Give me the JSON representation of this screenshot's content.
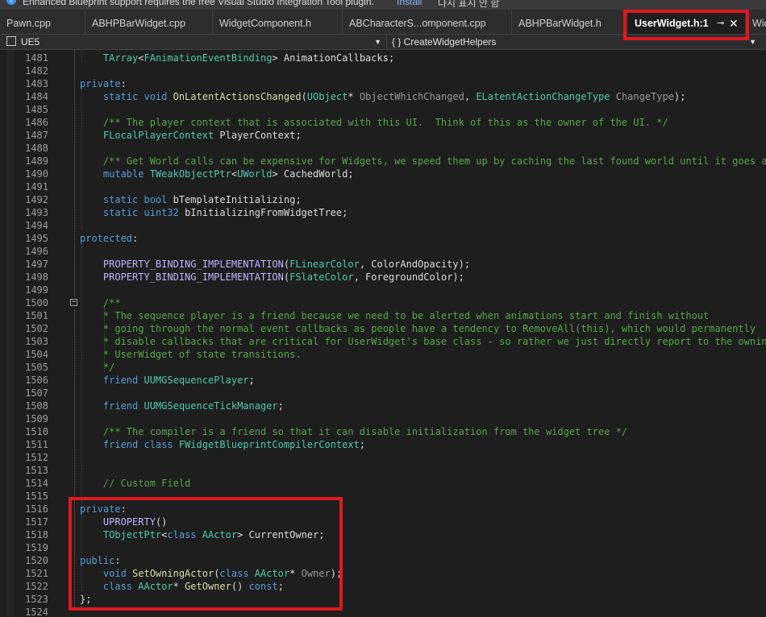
{
  "infobar": {
    "message": "Enhanced Blueprint support requires the free Visual Studio Integration Tool plugin.",
    "install_label": "Install",
    "dont_show_label": "다시 표시 안 함"
  },
  "tabs": [
    {
      "label": "Pawn.cpp"
    },
    {
      "label": "ABHPBarWidget.cpp"
    },
    {
      "label": "WidgetComponent.h"
    },
    {
      "label": "ABCharacterS...omponent.cpp"
    },
    {
      "label": "ABHPBarWidget.h"
    },
    {
      "label": "UserWidget.h:1",
      "active": true
    },
    {
      "label": "Widg"
    }
  ],
  "tab_controls": {
    "pin": "⊸",
    "close": "✕"
  },
  "navbar": {
    "project": "UE5",
    "member": "{ } CreateWidgetHelpers"
  },
  "colors": {
    "highlight_box": "#e0181d",
    "active_tab_accent": "#9d7ff0",
    "keyword": "#569cd6",
    "type": "#4ec9b0",
    "function": "#dcdcaa",
    "comment": "#57a64a",
    "macro": "#beb7ff"
  },
  "code_lines": [
    {
      "n": "1481",
      "tokens": [
        [
          "i2",
          ""
        ],
        [
          "ty",
          "TArray"
        ],
        [
          "p",
          "<"
        ],
        [
          "ty",
          "FAnimationEventBinding"
        ],
        [
          "p",
          "> AnimationCallbacks;"
        ]
      ]
    },
    {
      "n": "1482",
      "tokens": []
    },
    {
      "n": "1483",
      "tokens": [
        [
          "kw",
          "private"
        ],
        [
          "p",
          ":"
        ]
      ]
    },
    {
      "n": "1484",
      "tokens": [
        [
          "i2",
          ""
        ],
        [
          "kw",
          "static void "
        ],
        [
          "fn",
          "OnLatentActionsChanged"
        ],
        [
          "p",
          "("
        ],
        [
          "ty",
          "UObject"
        ],
        [
          "p",
          "* "
        ],
        [
          "pa",
          "ObjectWhichChanged"
        ],
        [
          "p",
          ", "
        ],
        [
          "ty",
          "ELatentActionChangeType"
        ],
        [
          "p",
          " "
        ],
        [
          "pa",
          "ChangeType"
        ],
        [
          "p",
          ");"
        ]
      ]
    },
    {
      "n": "1485",
      "tokens": []
    },
    {
      "n": "1486",
      "tokens": [
        [
          "i2",
          ""
        ],
        [
          "cm",
          "/** The player context that is associated with this UI.  Think of this as the owner of the UI. */"
        ]
      ]
    },
    {
      "n": "1487",
      "tokens": [
        [
          "i2",
          ""
        ],
        [
          "ty",
          "FLocalPlayerContext"
        ],
        [
          "p",
          " PlayerContext;"
        ]
      ]
    },
    {
      "n": "1488",
      "tokens": []
    },
    {
      "n": "1489",
      "tokens": [
        [
          "i2",
          ""
        ],
        [
          "cm",
          "/** Get World calls can be expensive for Widgets, we speed them up by caching the last found world until it goes away. */"
        ]
      ]
    },
    {
      "n": "1490",
      "tokens": [
        [
          "i2",
          ""
        ],
        [
          "kw",
          "mutable "
        ],
        [
          "ty",
          "TWeakObjectPtr"
        ],
        [
          "p",
          "<"
        ],
        [
          "ty",
          "UWorld"
        ],
        [
          "p",
          "> CachedWorld;"
        ]
      ]
    },
    {
      "n": "1491",
      "tokens": []
    },
    {
      "n": "1492",
      "tokens": [
        [
          "i2",
          ""
        ],
        [
          "kw",
          "static bool "
        ],
        [
          "p",
          "bTemplateInitializing;"
        ]
      ]
    },
    {
      "n": "1493",
      "tokens": [
        [
          "i2",
          ""
        ],
        [
          "kw",
          "static uint32 "
        ],
        [
          "p",
          "bInitializingFromWidgetTree;"
        ]
      ]
    },
    {
      "n": "1494",
      "tokens": []
    },
    {
      "n": "1495",
      "tokens": [
        [
          "kw",
          "protected"
        ],
        [
          "p",
          ":"
        ]
      ]
    },
    {
      "n": "1496",
      "tokens": []
    },
    {
      "n": "1497",
      "tokens": [
        [
          "i2",
          ""
        ],
        [
          "mac",
          "PROPERTY_BINDING_IMPLEMENTATION"
        ],
        [
          "p",
          "("
        ],
        [
          "ty",
          "FLinearColor"
        ],
        [
          "p",
          ", ColorAndOpacity);"
        ]
      ]
    },
    {
      "n": "1498",
      "tokens": [
        [
          "i2",
          ""
        ],
        [
          "mac",
          "PROPERTY_BINDING_IMPLEMENTATION"
        ],
        [
          "p",
          "("
        ],
        [
          "ty",
          "FSlateColor"
        ],
        [
          "p",
          ", ForegroundColor);"
        ]
      ]
    },
    {
      "n": "1499",
      "tokens": []
    },
    {
      "n": "1500",
      "tokens": [
        [
          "i2",
          ""
        ],
        [
          "cm",
          "/**"
        ]
      ],
      "fold": true
    },
    {
      "n": "1501",
      "tokens": [
        [
          "i2",
          ""
        ],
        [
          "cm",
          "* The sequence player is a friend because we need to be alerted when animations start and finish without"
        ]
      ]
    },
    {
      "n": "1502",
      "tokens": [
        [
          "i2",
          ""
        ],
        [
          "cm",
          "* going through the normal event callbacks as people have a tendency to RemoveAll(this), which would permanently"
        ]
      ]
    },
    {
      "n": "1503",
      "tokens": [
        [
          "i2",
          ""
        ],
        [
          "cm",
          "* disable callbacks that are critical for UserWidget's base class - so rather we just directly report to the owning"
        ]
      ]
    },
    {
      "n": "1504",
      "tokens": [
        [
          "i2",
          ""
        ],
        [
          "cm",
          "* UserWidget of state transitions."
        ]
      ]
    },
    {
      "n": "1505",
      "tokens": [
        [
          "i2",
          ""
        ],
        [
          "cm",
          "*/"
        ]
      ]
    },
    {
      "n": "1506",
      "tokens": [
        [
          "i2",
          ""
        ],
        [
          "kw",
          "friend "
        ],
        [
          "ty",
          "UUMGSequencePlayer"
        ],
        [
          "p",
          ";"
        ]
      ]
    },
    {
      "n": "1507",
      "tokens": []
    },
    {
      "n": "1508",
      "tokens": [
        [
          "i2",
          ""
        ],
        [
          "kw",
          "friend "
        ],
        [
          "ty",
          "UUMGSequenceTickManager"
        ],
        [
          "p",
          ";"
        ]
      ]
    },
    {
      "n": "1509",
      "tokens": []
    },
    {
      "n": "1510",
      "tokens": [
        [
          "i2",
          ""
        ],
        [
          "cm",
          "/** The compiler is a friend so that it can disable initialization from the widget tree */"
        ]
      ]
    },
    {
      "n": "1511",
      "tokens": [
        [
          "i2",
          ""
        ],
        [
          "kw",
          "friend class "
        ],
        [
          "ty",
          "FWidgetBlueprintCompilerContext"
        ],
        [
          "p",
          ";"
        ]
      ]
    },
    {
      "n": "1512",
      "tokens": []
    },
    {
      "n": "1513",
      "tokens": []
    },
    {
      "n": "1514",
      "tokens": [
        [
          "i2",
          ""
        ],
        [
          "cm",
          "// Custom Field"
        ]
      ]
    },
    {
      "n": "1515",
      "tokens": []
    },
    {
      "n": "1516",
      "tokens": [
        [
          "kw",
          "private"
        ],
        [
          "p",
          ":"
        ]
      ]
    },
    {
      "n": "1517",
      "tokens": [
        [
          "i2",
          ""
        ],
        [
          "mac",
          "UPROPERTY"
        ],
        [
          "p",
          "()"
        ]
      ]
    },
    {
      "n": "1518",
      "tokens": [
        [
          "i2",
          ""
        ],
        [
          "ty",
          "TObjectPtr"
        ],
        [
          "p",
          "<"
        ],
        [
          "kw",
          "class "
        ],
        [
          "ty",
          "AActor"
        ],
        [
          "p",
          "> CurrentOwner;"
        ]
      ]
    },
    {
      "n": "1519",
      "tokens": []
    },
    {
      "n": "1520",
      "tokens": [
        [
          "kw",
          "public"
        ],
        [
          "p",
          ":"
        ]
      ]
    },
    {
      "n": "1521",
      "tokens": [
        [
          "i2",
          ""
        ],
        [
          "kw",
          "void "
        ],
        [
          "fn",
          "SetOwningActor"
        ],
        [
          "p",
          "("
        ],
        [
          "kw",
          "class "
        ],
        [
          "ty",
          "AActor"
        ],
        [
          "p",
          "* "
        ],
        [
          "pa",
          "Owner"
        ],
        [
          "p",
          ");"
        ]
      ]
    },
    {
      "n": "1522",
      "tokens": [
        [
          "i2",
          ""
        ],
        [
          "kw",
          "class "
        ],
        [
          "ty",
          "AActor"
        ],
        [
          "p",
          "* "
        ],
        [
          "fn",
          "GetOwner"
        ],
        [
          "p",
          "() "
        ],
        [
          "kw",
          "const"
        ],
        [
          "p",
          ";"
        ]
      ]
    },
    {
      "n": "1523",
      "tokens": [
        [
          "p",
          "};"
        ]
      ]
    },
    {
      "n": "1524",
      "tokens": []
    }
  ]
}
